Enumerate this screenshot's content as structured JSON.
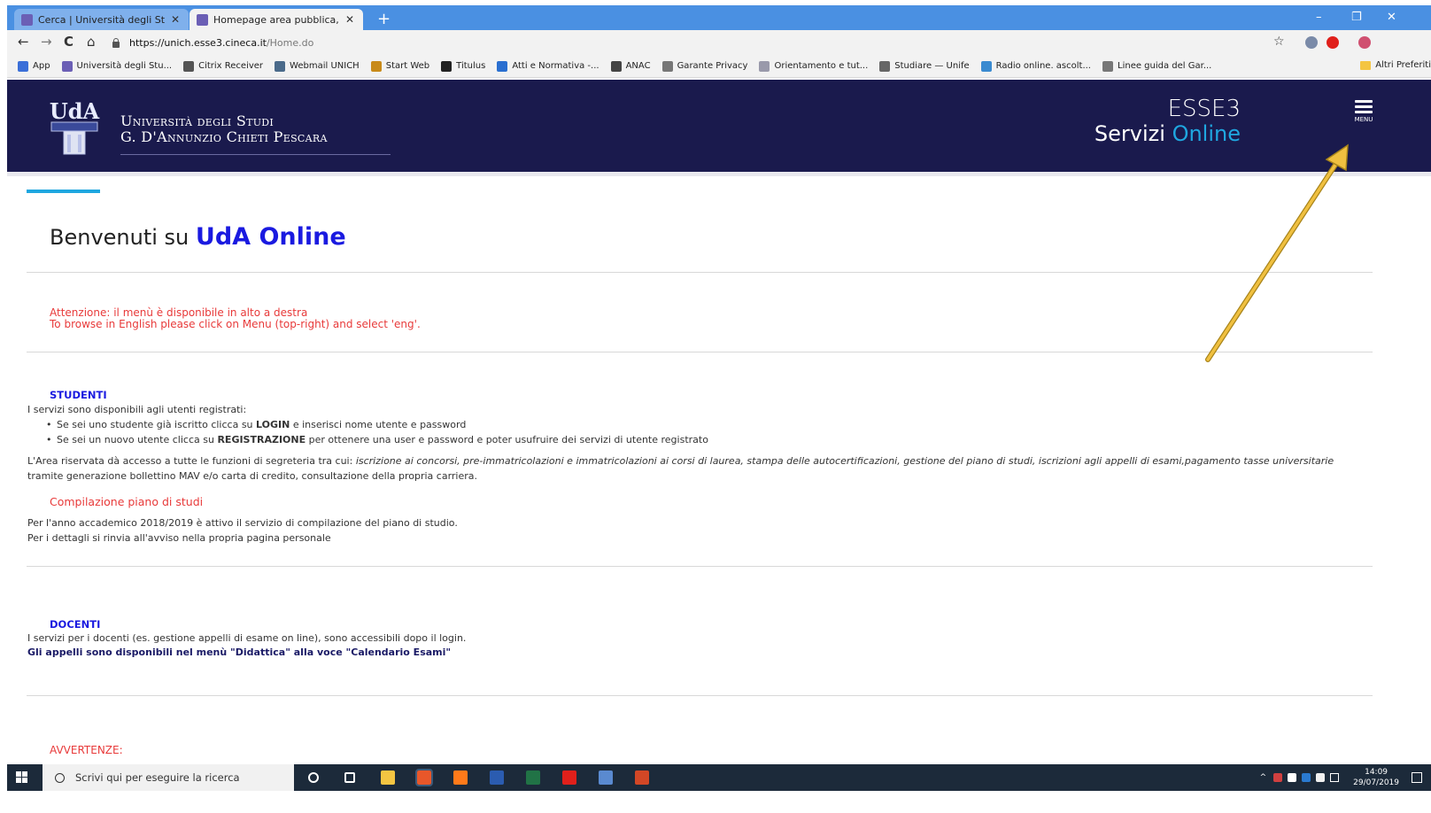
{
  "browser": {
    "tabs": [
      {
        "title": "Cerca | Università degli Studi \"G.",
        "active": false
      },
      {
        "title": "Homepage area pubblica, Univer",
        "active": true
      }
    ],
    "new_tab_label": "+",
    "window_controls": {
      "minimize": "–",
      "restore": "❐",
      "close": "✕"
    },
    "nav": {
      "back": "←",
      "forward": "→",
      "reload": "C",
      "home": "⌂"
    },
    "url_host": "https://unich.esse3.cineca.it",
    "url_path": "/Home.do",
    "star": "☆",
    "bookmarks": [
      {
        "label": "App",
        "color": "#3b6fd8"
      },
      {
        "label": "Università degli Stu...",
        "color": "#6b5fb5"
      },
      {
        "label": "Citrix Receiver",
        "color": "#555555"
      },
      {
        "label": "Webmail UNICH",
        "color": "#4a6a8a"
      },
      {
        "label": "Start Web",
        "color": "#c88a1a"
      },
      {
        "label": "Titulus",
        "color": "#222222"
      },
      {
        "label": "Atti e Normativa -...",
        "color": "#2a6fd0"
      },
      {
        "label": "ANAC",
        "color": "#444444"
      },
      {
        "label": "Garante Privacy",
        "color": "#777777"
      },
      {
        "label": "Orientamento e tut...",
        "color": "#9999aa"
      },
      {
        "label": "Studiare — Unife",
        "color": "#666666"
      },
      {
        "label": "Radio online. ascolt...",
        "color": "#3a8ad0"
      },
      {
        "label": "Linee guida del Gar...",
        "color": "#777777"
      }
    ],
    "other_bookmarks": "Altri Preferiti"
  },
  "header": {
    "logo_text": "UdA",
    "university_line1": "Università degli Studi",
    "university_line2": "G. D'Annunzio Chieti Pescara",
    "app_name": "ESSE3",
    "servizi": "Servizi",
    "online": "Online",
    "menu_label": "MENU"
  },
  "content": {
    "welcome_prefix": "Benvenuti su",
    "welcome_brand": "UdA Online",
    "attention_line1": "Attenzione: il menù è disponibile in alto a destra",
    "attention_line2": "To browse in English please click on Menu (top-right) and select 'eng'.",
    "studenti": {
      "title": "STUDENTI",
      "intro": "I servizi sono disponibili agli utenti registrati:",
      "bullet1_pre": "Se sei uno studente già iscritto clicca su",
      "bullet1_bold": "LOGIN",
      "bullet1_post": "e inserisci nome utente e password",
      "bullet2_pre": "Se sei un nuovo utente clicca su",
      "bullet2_bold": "REGISTRAZIONE",
      "bullet2_post": "per ottenere una user e password e poter usufruire dei servizi di utente registrato",
      "area_pre": "L'Area riservata dà accesso a tutte le funzioni di segreteria tra cui:",
      "area_italic": "iscrizione ai concorsi, pre-immatricolazioni e immatricolazioni ai corsi di laurea, stampa delle autocertificazioni, gestione del piano di studi, iscrizioni agli appelli di esami,pagamento tasse universitarie",
      "area_post": "tramite generazione bollettino MAV e/o carta di credito, consultazione della propria carriera.",
      "piano_title": "Compilazione piano di studi",
      "piano_line1": "Per l'anno accademico 2018/2019 è attivo il servizio di compilazione del piano di studio.",
      "piano_line2": "Per i dettagli si rinvia all'avviso nella propria pagina personale"
    },
    "docenti": {
      "title": "DOCENTI",
      "intro": "I servizi per i docenti (es. gestione appelli di esame on line), sono accessibili dopo il login.",
      "link": "Gli appelli sono disponibili nel menù \"Didattica\" alla voce \"Calendario Esami\""
    },
    "avvertenze": "AVVERTENZE:"
  },
  "taskbar": {
    "search_placeholder": "Scrivi qui per eseguire la ricerca",
    "time": "14:09",
    "date": "29/07/2019",
    "icons": [
      {
        "name": "cortana",
        "color": "#ffffff"
      },
      {
        "name": "task-view",
        "color": "#ffffff"
      },
      {
        "name": "file-explorer",
        "color": "#f4c542"
      },
      {
        "name": "chrome",
        "color": "#4caf50"
      },
      {
        "name": "firefox",
        "color": "#ff7a1a"
      },
      {
        "name": "word",
        "color": "#2b5cb0"
      },
      {
        "name": "excel",
        "color": "#217346"
      },
      {
        "name": "acrobat",
        "color": "#e0201b"
      },
      {
        "name": "app",
        "color": "#5a8ad0"
      },
      {
        "name": "powerpoint",
        "color": "#d24726"
      }
    ]
  }
}
